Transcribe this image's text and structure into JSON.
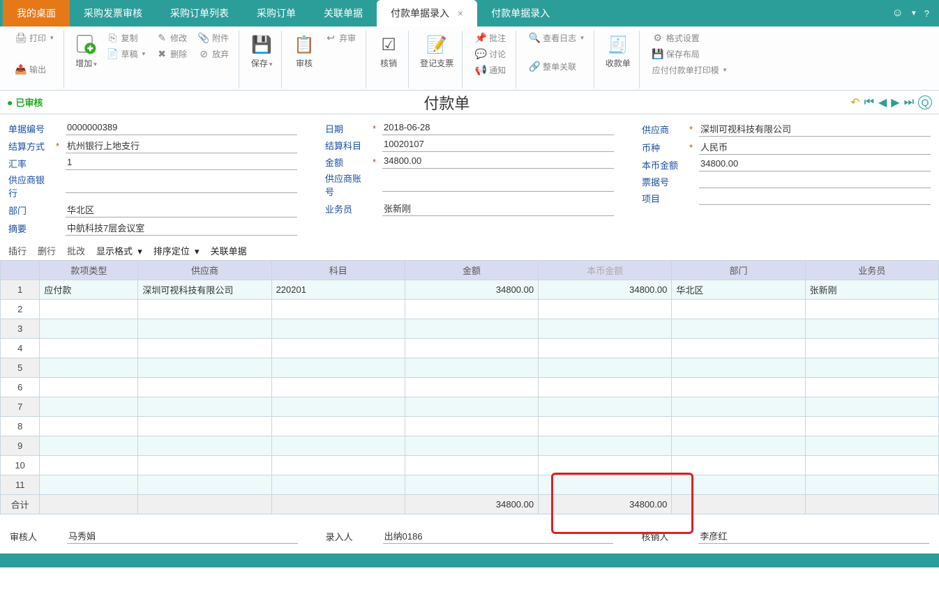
{
  "tabs": {
    "home": "我的桌面",
    "items": [
      "采购发票审核",
      "采购订单列表",
      "采购订单",
      "关联单据"
    ],
    "active": "付款单据录入",
    "after": [
      "付款单据录入"
    ]
  },
  "ribbon": {
    "print": "打印",
    "output": "输出",
    "add": "增加",
    "copy": "复制",
    "modify": "修改",
    "attach": "附件",
    "draft": "草稿",
    "delete": "删除",
    "discard": "放弃",
    "save": "保存",
    "audit": "审核",
    "abandon": "弃审",
    "writeoff": "核销",
    "register": "登记支票",
    "note": "批注",
    "discuss": "讨论",
    "notify": "通知",
    "viewlog": "查看日志",
    "fullrel": "整单关联",
    "receipt": "收款单",
    "formatset": "格式设置",
    "savelayout": "保存布局",
    "printtpl": "应付付款单打印模"
  },
  "title": "付款单",
  "status": "已审核",
  "form": {
    "col1": {
      "docno_l": "单据编号",
      "docno": "0000000389",
      "settle_l": "结算方式",
      "settle": "杭州银行上地支行",
      "rate_l": "汇率",
      "rate": "1",
      "bank_l": "供应商银行",
      "bank": "",
      "dept_l": "部门",
      "dept": "华北区",
      "summary_l": "摘要",
      "summary": "中航科技7层会议室"
    },
    "col2": {
      "date_l": "日期",
      "date": "2018-06-28",
      "acct_l": "结算科目",
      "acct": "10020107",
      "amt_l": "金额",
      "amt": "34800.00",
      "vacct_l": "供应商账号",
      "vacct": "",
      "emp_l": "业务员",
      "emp": "张新刚"
    },
    "col3": {
      "vendor_l": "供应商",
      "vendor": "深圳可视科技有限公司",
      "curr_l": "币种",
      "curr": "人民币",
      "local_l": "本币金额",
      "local": "34800.00",
      "bill_l": "票据号",
      "bill": "",
      "proj_l": "项目",
      "proj": ""
    }
  },
  "gridtool": {
    "ins": "插行",
    "del": "删行",
    "batch": "批改",
    "dispfmt": "显示格式",
    "sort": "排序定位",
    "rel": "关联单据"
  },
  "grid": {
    "headers": [
      "",
      "款项类型",
      "供应商",
      "科目",
      "金额",
      "本币金额",
      "部门",
      "业务员"
    ],
    "rows": [
      {
        "n": "1",
        "type": "应付款",
        "vendor": "深圳可视科技有限公司",
        "acct": "220201",
        "amt": "34800.00",
        "local": "34800.00",
        "dept": "华北区",
        "emp": "张新刚"
      }
    ],
    "blank": [
      "2",
      "3",
      "4",
      "5",
      "6",
      "7",
      "8",
      "9",
      "10",
      "11"
    ],
    "total_l": "合计",
    "total_amt": "34800.00",
    "total_local": "34800.00"
  },
  "footer": {
    "auditor_l": "审核人",
    "auditor": "马秀娟",
    "entry_l": "录入人",
    "entry": "出纳0186",
    "verifier_l": "核销人",
    "verifier": "李彦红"
  }
}
